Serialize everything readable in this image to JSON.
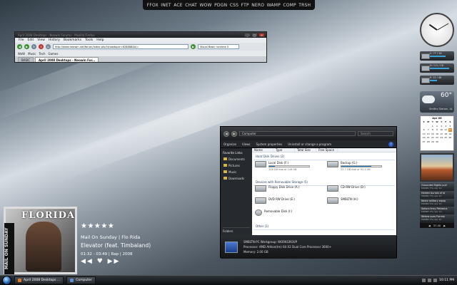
{
  "launcher": [
    "FFOX",
    "INET",
    "ACE",
    "CHAT",
    "WOW",
    "PDGN",
    "CSS",
    "FTP",
    "NERO",
    "WAMP",
    "COMP",
    "TRSH"
  ],
  "browser": {
    "title": "April 2008 Desktops - Neowin Forums - Mozilla Firefox",
    "menu": [
      "File",
      "Edit",
      "View",
      "History",
      "Bookmarks",
      "Tools",
      "Help"
    ],
    "bookmarks": [
      "WoW",
      "Music",
      "Tech",
      "Games"
    ],
    "url": "http://www.neowin.net/forum/index.php?showtopic=628888&hl=",
    "search": "Visual Basic runtime 5",
    "tabs": [
      "BASIC",
      "April 2008 Desktops - Neowin For..."
    ]
  },
  "explorer": {
    "address": "Computer",
    "search_placeholder": "Search",
    "toolbar": [
      "Organize",
      "Views",
      "System properties",
      "Uninstall or change a program"
    ],
    "columns": [
      "Name",
      "Type",
      "Total Size",
      "Free Space"
    ],
    "sidebar": {
      "heading": "Favorite Links",
      "links": [
        "Documents",
        "Pictures",
        "Music",
        "Downloads"
      ],
      "folders": "Folders"
    },
    "groups": {
      "hard": "Hard Disk Drives (2)",
      "removable": "Devices with Removable Storage (5)",
      "other": "Other (1)"
    },
    "drives": {
      "local": {
        "name": "Local Disk (F:)",
        "free": "128 GB free of 149 GB",
        "used_fraction": 0.14
      },
      "backup": {
        "name": "Backup (G:)",
        "free": "22.7 GB free of 92.1 GB",
        "used_fraction": 0.75
      },
      "floppy": "Floppy Disk Drive (A:)",
      "cdrw": "CD-RW Drive (D:)",
      "dvd": "DVD RW Drive (E:)",
      "smb": "SMBLTN (H:)",
      "removable": "Removable Disk (I:)"
    },
    "detail": {
      "name": "SMBLTN-PC  Workgroup: WORKGROUP",
      "processor": "Processor: AMD Athlon(tm) 64 X2 Dual Core Processor 3600+",
      "memory": "Memory: 2.00 GB"
    }
  },
  "gadgets": {
    "meters": [
      "C: 77 / 28",
      "D: 111 / 18",
      "E: 22 / 48"
    ],
    "weather": {
      "temp": "60°",
      "location": "Smiths Station, AL"
    },
    "calendar": {
      "month": "Apr 08",
      "days": [
        "S",
        "M",
        "T",
        "W",
        "T",
        "F",
        "S"
      ],
      "dates": [
        "",
        "",
        "1",
        "2",
        "3",
        "4",
        "5",
        "6",
        "7",
        "8",
        "9",
        "10",
        "11",
        "12",
        "13",
        "14",
        "15",
        "16",
        "17",
        "18",
        "19",
        "20",
        "21",
        "22",
        "23",
        "24",
        "25",
        "26",
        "27",
        "28",
        "29",
        "30",
        "",
        "",
        ""
      ],
      "today": "12"
    },
    "feeds": [
      {
        "title": "Grounded flights puli",
        "src": "MSNBC",
        "time": "Thu Apr 10"
      },
      {
        "title": "Hidden burials of id",
        "src": "MSNBC",
        "time": "Thu Apr 10"
      },
      {
        "title": "Naive military equip",
        "src": "MSNBC",
        "time": "Thu Apr 10"
      },
      {
        "title": "Sailors ferry Petraeus",
        "src": "MSNBC",
        "time": "Thu Apr 10"
      },
      {
        "title": "Widow sues Forrest",
        "src": "MSNBC",
        "time": "Thu Apr 10"
      }
    ],
    "feed_nav": "37-40"
  },
  "player": {
    "stars": "★★★★★",
    "album": "Mail On Sunday | Flo Rida",
    "song": "Elevator (feat. Timbaland)",
    "meta": "01:32 - 03:49 | Rap | 2008",
    "controls": "◀◀ ♥ ▶▶",
    "cover_title": "FLORIDA",
    "cover_side": "MAIL ON SUNDAY"
  },
  "taskbar": {
    "items": [
      "April 2008 Desktops ...",
      "Computer"
    ],
    "clock": "10:11 PM"
  }
}
